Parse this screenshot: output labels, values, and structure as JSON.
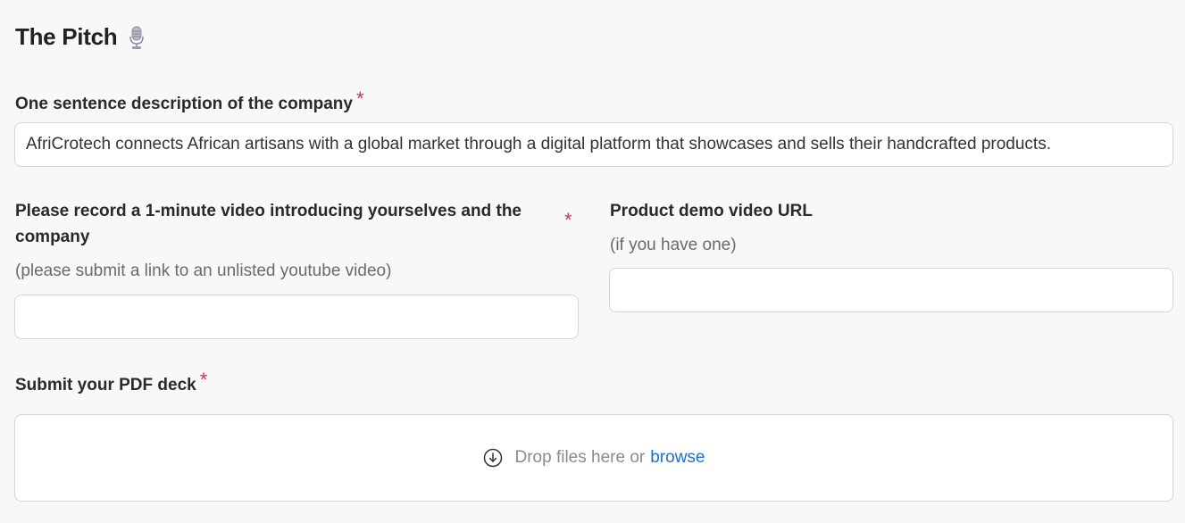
{
  "section": {
    "title": "The Pitch",
    "title_icon": "microphone-icon"
  },
  "description": {
    "label": "One sentence description of the company",
    "required_mark": "*",
    "value": "AfriCrotech connects African artisans with a global market through a digital platform that showcases and sells their handcrafted products."
  },
  "intro_video": {
    "label": "Please record a 1-minute video introducing yourselves and the company",
    "required_mark": "*",
    "hint": "(please submit a link to an unlisted youtube video)",
    "value": ""
  },
  "demo_video": {
    "label": "Product demo video URL",
    "hint": "(if you have one)",
    "value": ""
  },
  "pdf_deck": {
    "label": "Submit your PDF deck",
    "required_mark": "*",
    "drop_text": "Drop files here or",
    "browse_label": "browse",
    "drop_icon": "download-circle-icon"
  },
  "colors": {
    "background": "#f8f8f8",
    "required": "#d1326a",
    "link": "#1f6fd1"
  }
}
